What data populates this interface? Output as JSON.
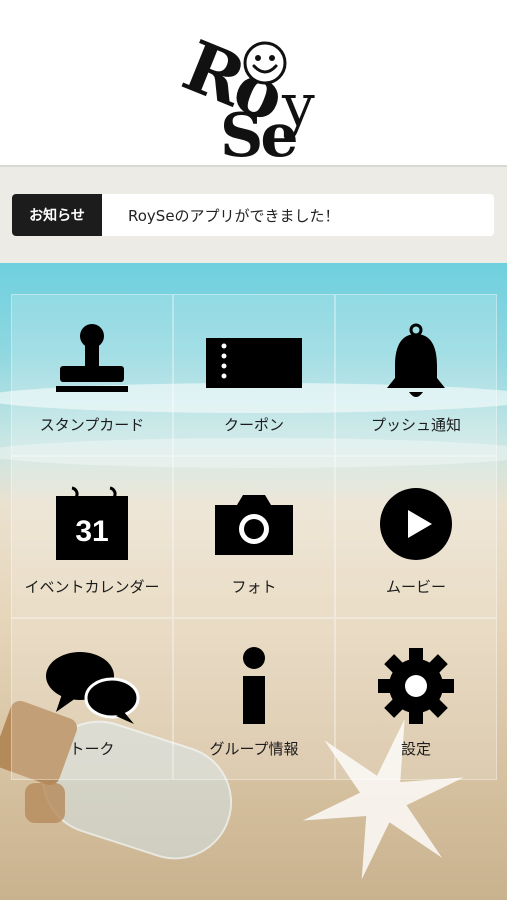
{
  "logo": {
    "line1": "Ro",
    "line1b": "y",
    "line2": "Se"
  },
  "notice": {
    "label": "お知らせ",
    "text": "RoySeのアプリができました！"
  },
  "menu": [
    {
      "label": "スタンプカード",
      "icon": "stamp-icon"
    },
    {
      "label": "クーポン",
      "icon": "coupon-icon"
    },
    {
      "label": "プッシュ通知",
      "icon": "bell-icon"
    },
    {
      "label": "イベントカレンダー",
      "icon": "calendar-icon",
      "icon_text": "31"
    },
    {
      "label": "フォト",
      "icon": "camera-icon"
    },
    {
      "label": "ムービー",
      "icon": "play-icon"
    },
    {
      "label": "トーク",
      "icon": "chat-bubbles-icon"
    },
    {
      "label": "グループ情報",
      "icon": "info-icon"
    },
    {
      "label": "設定",
      "icon": "gear-icon"
    }
  ],
  "colors": {
    "icon": "#000000",
    "notice_label_bg": "#1c1c1c",
    "sky": "#6ed0de",
    "sand": "#e6d6bb"
  }
}
